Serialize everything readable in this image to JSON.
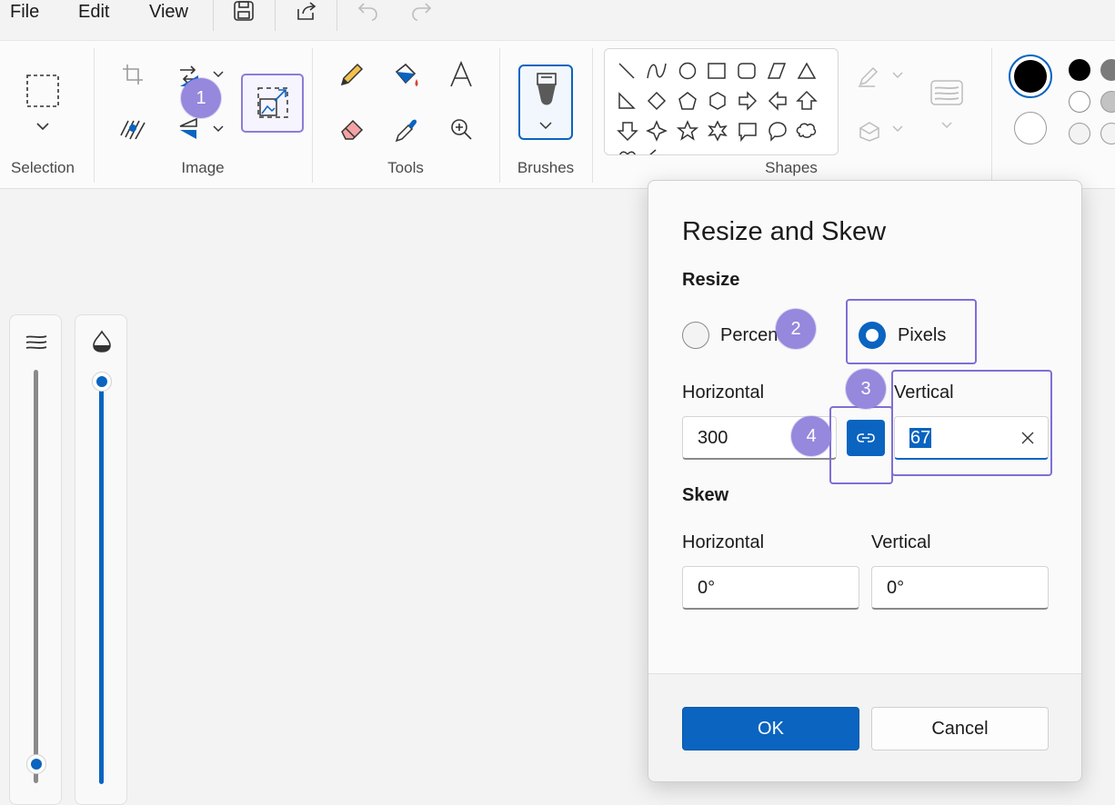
{
  "menubar": {
    "items": [
      {
        "label": "File"
      },
      {
        "label": "Edit"
      },
      {
        "label": "View"
      }
    ]
  },
  "ribbon": {
    "groups": {
      "selection": "Selection",
      "image": "Image",
      "tools": "Tools",
      "brushes": "Brushes",
      "shapes": "Shapes"
    }
  },
  "dialog": {
    "title": "Resize and Skew",
    "resize_section": "Resize",
    "percentage_label": "Percentage",
    "pixels_label": "Pixels",
    "selected_unit": "Pixels",
    "horizontal_label": "Horizontal",
    "vertical_label": "Vertical",
    "horizontal_value": "300",
    "vertical_value": "67",
    "skew_section": "Skew",
    "skew_horizontal_label": "Horizontal",
    "skew_vertical_label": "Vertical",
    "skew_horizontal_value": "0°",
    "skew_vertical_value": "0°",
    "ok_label": "OK",
    "cancel_label": "Cancel"
  },
  "annotations": {
    "badge_1": "1",
    "badge_2": "2",
    "badge_3": "3",
    "badge_4": "4"
  },
  "sliders": {
    "size_level": 0.0,
    "opacity_level": 1.0
  },
  "colors": {
    "accent": "#0a64c0",
    "annotation": "#9588dd",
    "primary_color": "#000000",
    "secondary_color": "#ffffff"
  }
}
